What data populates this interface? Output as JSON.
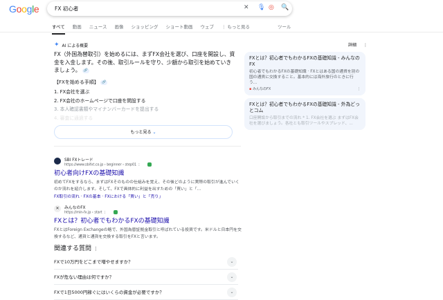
{
  "header": {
    "logo": "Google",
    "query": "FX 初心者"
  },
  "tabs": [
    "すべて",
    "動画",
    "ニュース",
    "画像",
    "ショッピング",
    "ショート動画",
    "ウェブ",
    "⋮ もっと見る"
  ],
  "tools": "ツール",
  "ai_overview": {
    "label": "AI による概要",
    "details": "詳細",
    "paragraph": "FX（外国為替取引）を始めるには、まずFX会社を選び、口座を開設し、資金を入金します。その後、取引ルールを守り、少額から取引を始めていきましょう。",
    "steps_heading": "【FXを始める手順】",
    "steps": [
      "1.  FX会社を選ぶ",
      "2.  FX会社のホームページで口座を開設する",
      "3.  本人確認書類やマイナンバーカードを提出する",
      "4.  審査に通過する"
    ],
    "more": "もっと見る",
    "sources": [
      {
        "title": "FXとは？初心者でもわかるFXの基礎知識 - みんなのFX",
        "snippet": "初心者でもわかるFXの基礎知識 · FXとはある国の通貨を別の国の通貨に交換すること。基本的には海外旅行のときに行う...",
        "site": "みんなのFX"
      },
      {
        "title": "FXとは？初心者でもわかるFXの基礎知識 - 外為どっとコム",
        "snippet": "口座開設から取引までの流れ * 1. FX会社を選ぶ まずはFX会社を選びましょう。各社とも取引ツールやスプレッド、..."
      }
    ]
  },
  "results": [
    {
      "source": "SBI FXトレード",
      "url": "https://www.sbifxt.co.jp › beginner › step01",
      "title": "初心者向けFXの基礎知識",
      "snippet": "初めてFXをするなら、まずはFXそのものの仕組みを覚え、その後どのように実際の取引が進んでいくのか流れを紹介します。そして、FXで具体的に利益を出すための「買い」と「...",
      "links": "FX取引の流れ · FXの基本 · FXにおける「買い」と「売り」"
    },
    {
      "source": "みんなのFX",
      "url": "https://min-fx.jp › start",
      "title": "FXとは？初心者でもわかるFXの基礎知識",
      "snippet": "FXとはForeign Exchangeの略で、外国為替証拠金取引と呼ばれている投資です。米ドルと日本円を交換するなど、通貨と通貨を交換する取引をFXと言います。"
    }
  ],
  "related": {
    "heading": "関連する質問",
    "questions": [
      "FXで10万円をどこまで増やせますか？",
      "FXが危ない理由は何ですか？",
      "FXで1日5000円稼ぐにはいくらの資金が必要ですか？"
    ]
  }
}
